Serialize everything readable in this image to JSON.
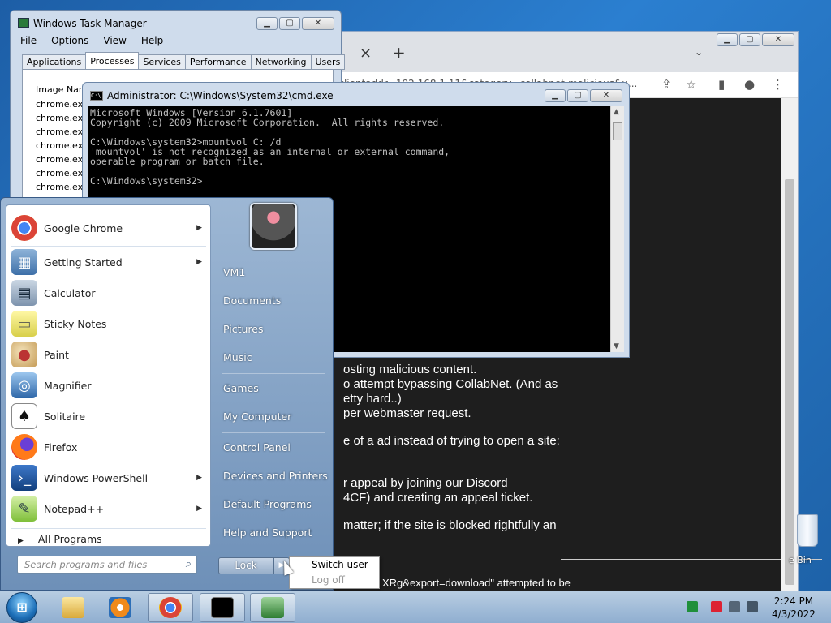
{
  "chrome": {
    "tab_close": "×",
    "new_tab": "+",
    "tab_dropdown": "⌄",
    "url_text": "?clientaddr=192.168.1.11&category=collabnet-malicious&u...",
    "content_lines": [
      "osting malicious content.",
      "o attempt bypassing CollabNet. (And as",
      "etty hard..)",
      "per webmaster request.",
      "e of a ad instead of trying to open a site:",
      "r appeal by joining our Discord",
      "4CF) and creating an appeal ticket.",
      "matter; if the site is blocked rightfully an",
      "XRg&export=download\" attempted to be"
    ]
  },
  "taskmanager": {
    "title": "Windows Task Manager",
    "menu": [
      "File",
      "Options",
      "View",
      "Help"
    ],
    "tabs": [
      "Applications",
      "Processes",
      "Services",
      "Performance",
      "Networking",
      "Users"
    ],
    "active_tab": "Processes",
    "column_header": "Image Name",
    "rows": [
      "chrome.exe",
      "chrome.exe",
      "chrome.exe",
      "chrome.exe",
      "chrome.exe",
      "chrome.exe",
      "chrome.exe"
    ]
  },
  "cmd": {
    "title": "Administrator: C:\\Windows\\System32\\cmd.exe",
    "icon_text": "C:\\",
    "console": "Microsoft Windows [Version 6.1.7601]\nCopyright (c) 2009 Microsoft Corporation.  All rights reserved.\n\nC:\\Windows\\system32>mountvol C: /d\n'mountvol' is not recognized as an internal or external command,\noperable program or batch file.\n\nC:\\Windows\\system32>"
  },
  "startmenu": {
    "programs": [
      {
        "label": "Google Chrome",
        "submenu": true
      },
      {
        "label": "Getting Started",
        "submenu": true
      },
      {
        "label": "Calculator",
        "submenu": false
      },
      {
        "label": "Sticky Notes",
        "submenu": false
      },
      {
        "label": "Paint",
        "submenu": false
      },
      {
        "label": "Magnifier",
        "submenu": false
      },
      {
        "label": "Solitaire",
        "submenu": false
      },
      {
        "label": "Firefox",
        "submenu": false
      },
      {
        "label": "Windows PowerShell",
        "submenu": true
      },
      {
        "label": "Notepad++",
        "submenu": true
      }
    ],
    "all_programs": "All Programs",
    "search_placeholder": "Search programs and files",
    "right_items": [
      "VM1",
      "Documents",
      "Pictures",
      "Music",
      "Games",
      "My Computer",
      "Control Panel",
      "Devices and Printers",
      "Default Programs",
      "Help and Support"
    ],
    "lock_label": "Lock",
    "power_submenu": [
      "Switch user",
      "Log off"
    ]
  },
  "desktop": {
    "recycle_label": "e Bin"
  },
  "taskbar": {
    "time": "2:24 PM",
    "date": "4/3/2022"
  },
  "colors": {
    "console_bg": "#000000",
    "console_fg": "#c0c0c0",
    "browser_content_bg": "#1e1e1e"
  }
}
